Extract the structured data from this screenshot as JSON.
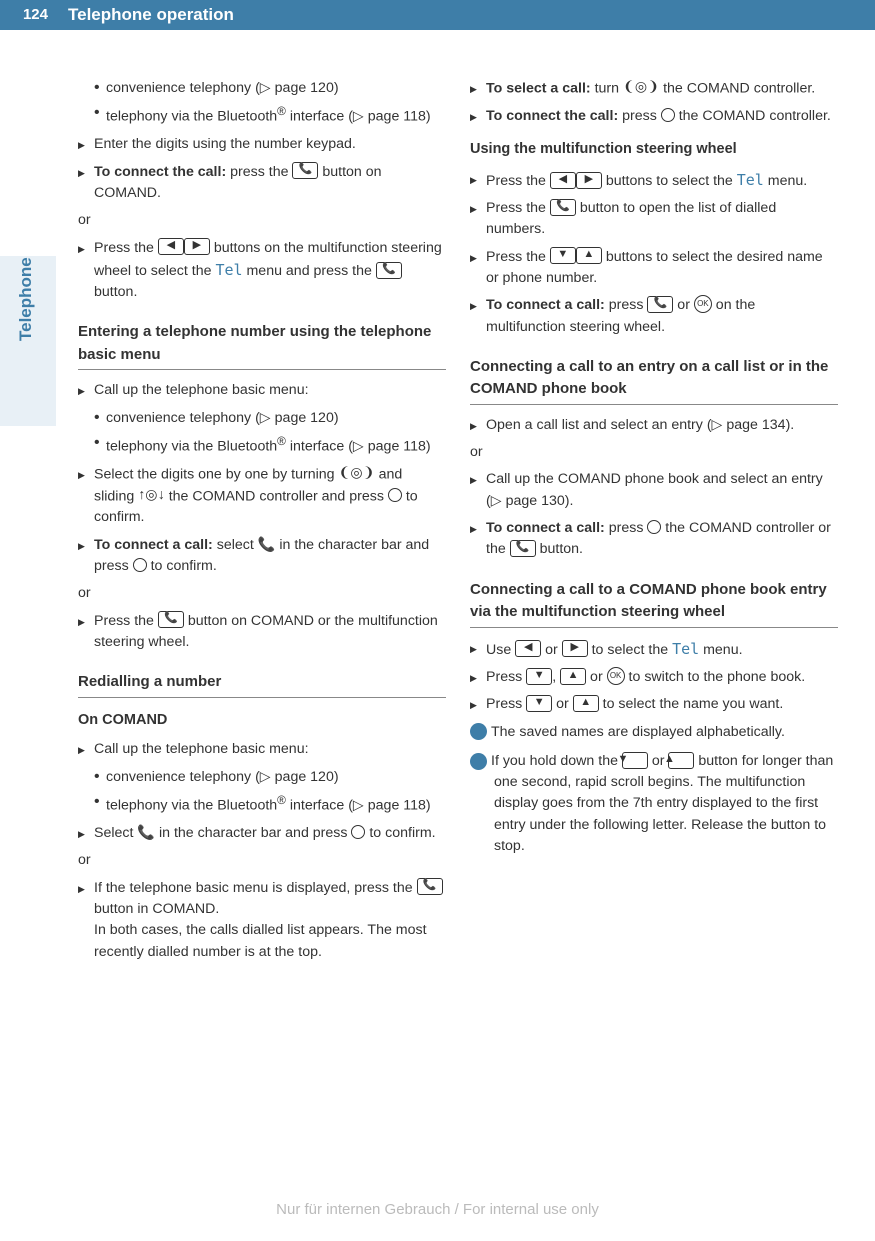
{
  "page_number": "124",
  "header_title": "Telephone operation",
  "side_tab": "Telephone",
  "tel_menu": "Tel",
  "ok_label": "OK",
  "watermark": "Nur für internen Gebrauch / For internal use only",
  "left": {
    "sub1a": "convenience telephony (▷ page 120)",
    "sub1b_a": "telephony via the Bluetooth",
    "sub1b_b": " interface (▷ page 118)",
    "step2": "Enter the digits using the number keypad.",
    "step3_bold": "To connect the call:",
    "step3_rest_a": " press the ",
    "step3_rest_b": " button on COMAND.",
    "or1": "or",
    "step4_a": "Press the ",
    "step4_b": " buttons on the multifunction steering wheel to select the ",
    "step4_c": " menu and press the ",
    "step4_d": " button.",
    "h2a": "Entering a telephone number using the telephone basic menu",
    "a_step1": "Call up the telephone basic menu:",
    "a_sub1": "convenience telephony (▷ page 120)",
    "a_sub2a": "telephony via the Bluetooth",
    "a_sub2b": " interface (▷ page 118)",
    "a_step2_a": "Select the digits one by one by turning ",
    "a_step2_b": " and sliding ",
    "a_step2_c": " the COMAND controller and press ",
    "a_step2_d": " to confirm.",
    "a_step3_bold": "To connect a call:",
    "a_step3_a": " select ",
    "a_step3_b": " in the character bar and press ",
    "a_step3_c": " to confirm.",
    "a_or": "or",
    "a_step4_a": "Press the ",
    "a_step4_b": " button on COMAND or the multifunction steering wheel.",
    "h2b": "Redialling a number",
    "h3a": "On COMAND",
    "b_step1": "Call up the telephone basic menu:",
    "b_sub1": "convenience telephony (▷ page 120)",
    "b_sub2a": "telephony via the Bluetooth",
    "b_sub2b": " interface (▷ page 118)",
    "b_step2_a": "Select ",
    "b_step2_b": " in the character bar and press ",
    "b_step2_c": " to confirm.",
    "b_or": "or",
    "b_step3_a": "If the telephone basic menu is displayed, press the ",
    "b_step3_b": " button in COMAND.",
    "b_step3_c": "In both cases, the calls dialled list appears. The most recently dialled number is at the top."
  },
  "right": {
    "step1_bold": "To select a call:",
    "step1_a": " turn ",
    "step1_b": " the COMAND controller.",
    "step2_bold": "To connect the call:",
    "step2_a": " press ",
    "step2_b": " the COMAND controller.",
    "h3a": "Using the multifunction steering wheel",
    "s3_a": "Press the ",
    "s3_b": " buttons to select the ",
    "s3_c": " menu.",
    "s4_a": "Press the ",
    "s4_b": " button to open the list of dialled numbers.",
    "s5_a": "Press the ",
    "s5_b": " buttons to select the desired name or phone number.",
    "s6_bold": "To connect a call:",
    "s6_a": " press ",
    "s6_b": " or ",
    "s6_c": " on the multifunction steering wheel.",
    "h2a": "Connecting a call to an entry on a call list or in the COMAND phone book",
    "c1": "Open a call list and select an entry (▷ page 134).",
    "c_or": "or",
    "c2": "Call up the COMAND phone book and select an entry (▷ page 130).",
    "c3_bold": "To connect a call:",
    "c3_a": " press ",
    "c3_b": " the COMAND controller or the ",
    "c3_c": " button.",
    "h2b": "Connecting a call to a COMAND phone book entry via the multifunction steering wheel",
    "d1_a": "Use ",
    "d1_b": " or ",
    "d1_c": " to select the ",
    "d1_d": " menu.",
    "d2_a": "Press ",
    "d2_b": ", ",
    "d2_c": " or ",
    "d2_d": " to switch to the phone book.",
    "d3_a": "Press ",
    "d3_b": " or ",
    "d3_c": " to select the name you want.",
    "info1": "The saved names are displayed alphabetically.",
    "info2_a": "If you hold down the ",
    "info2_b": " or ",
    "info2_c": " button for longer than one second, rapid scroll begins. The multifunction display goes from the 7th entry displayed to the first entry under the following letter. Release the button to stop."
  }
}
